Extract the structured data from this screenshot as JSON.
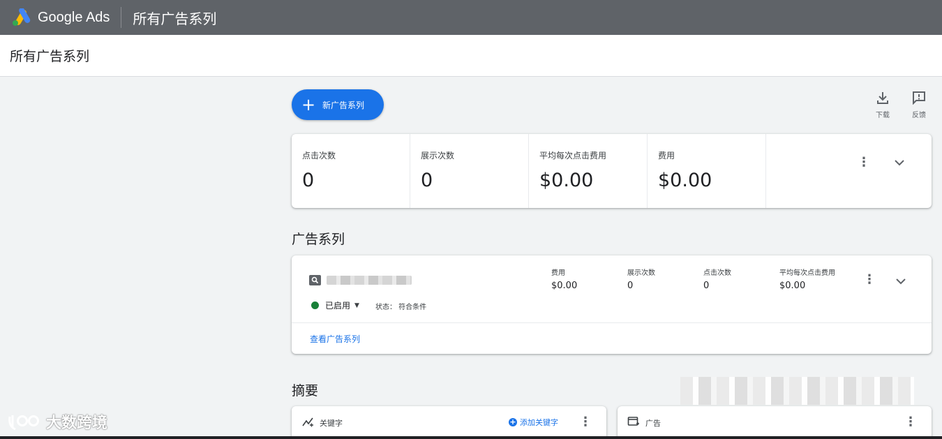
{
  "app": {
    "brand": "Google Ads",
    "page_title": "所有广告系列",
    "colors": {
      "topbar": "#5f6368",
      "primary": "#1a73e8",
      "enabled": "#188038"
    }
  },
  "subheader": {
    "title": "所有广告系列"
  },
  "toolbar": {
    "new_campaign_label": "新广告系列",
    "download_label": "下载",
    "feedback_label": "反馈"
  },
  "metrics": [
    {
      "label": "点击次数",
      "value": "0"
    },
    {
      "label": "展示次数",
      "value": "0"
    },
    {
      "label": "平均每次点击费用",
      "value": "$0.00"
    },
    {
      "label": "费用",
      "value": "$0.00"
    }
  ],
  "campaigns_section": {
    "title": "广告系列",
    "campaign": {
      "type_icon": "search-icon",
      "status": "已启用",
      "status_detail": "状态： 符合条件",
      "stats": [
        {
          "label": "费用",
          "value": "$0.00"
        },
        {
          "label": "展示次数",
          "value": "0"
        },
        {
          "label": "点击次数",
          "value": "0"
        },
        {
          "label": "平均每次点击费用",
          "value": "$0.00"
        }
      ],
      "view_link": "查看广告系列"
    }
  },
  "summary": {
    "title": "摘要",
    "keywords_card": {
      "label": "关键字",
      "add_label": "添加关键字"
    },
    "ads_card": {
      "label": "广告"
    }
  },
  "watermark": {
    "text": "大数跨境"
  }
}
